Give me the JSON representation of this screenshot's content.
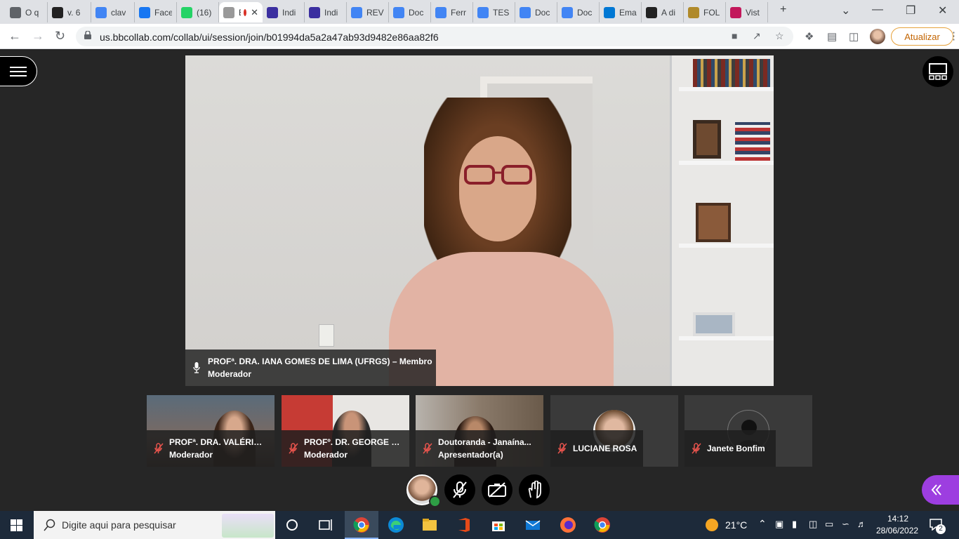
{
  "browser": {
    "tabs": [
      {
        "label": "O q",
        "favicon": "chrome-icon",
        "color": "#5f6368"
      },
      {
        "label": "v. 6",
        "favicon": "pkp-icon",
        "color": "#222222"
      },
      {
        "label": "clav",
        "favicon": "google-icon",
        "color": "#4285f4"
      },
      {
        "label": "Face",
        "favicon": "facebook-icon",
        "color": "#1877f2"
      },
      {
        "label": "(16)",
        "favicon": "whatsapp-icon",
        "color": "#25d366"
      },
      {
        "label": "B",
        "favicon": "collab-icon",
        "color": "#999999"
      },
      {
        "label": "Indi",
        "favicon": "indi-icon",
        "color": "#3b2fa0"
      },
      {
        "label": "Indi",
        "favicon": "indi-icon",
        "color": "#3b2fa0"
      },
      {
        "label": "REV",
        "favicon": "docs-icon",
        "color": "#4285f4"
      },
      {
        "label": "Doc",
        "favicon": "docs-icon",
        "color": "#4285f4"
      },
      {
        "label": "Ferr",
        "favicon": "docs-icon",
        "color": "#4285f4"
      },
      {
        "label": "TES",
        "favicon": "docs-icon",
        "color": "#4285f4"
      },
      {
        "label": "Doc",
        "favicon": "docs-icon",
        "color": "#4285f4"
      },
      {
        "label": "Doc",
        "favicon": "docs-icon",
        "color": "#4285f4"
      },
      {
        "label": "Ema",
        "favicon": "outlook-icon",
        "color": "#0078d4"
      },
      {
        "label": "A di",
        "favicon": "bookmark-icon",
        "color": "#222222"
      },
      {
        "label": "FOL",
        "favicon": "crest-icon",
        "color": "#b08a2a"
      },
      {
        "label": "Vist",
        "favicon": "a-icon",
        "color": "#c2185b"
      }
    ],
    "url": "us.bbcollab.com/collab/ui/session/join/b01994da5a2a47ab93d9482e86aa82f6",
    "update_label": "Atualizar"
  },
  "main_speaker": {
    "caption_line1": "PROFª. DRA. IANA GOMES DE LIMA (UFRGS) – Membro",
    "caption_line2": "Moderador"
  },
  "participants": [
    {
      "name": "PROFª. DRA. VALÉRIA ...",
      "role": "Moderador"
    },
    {
      "name": "PROFº. DR. GEORGE S...",
      "role": "Moderador"
    },
    {
      "name": "Doutoranda - Janaína...",
      "role": "Apresentador(a)"
    },
    {
      "name": "LUCIANE ROSA",
      "role": ""
    },
    {
      "name": "Janete Bonfim",
      "role": ""
    }
  ],
  "taskbar": {
    "search_placeholder": "Digite aqui para pesquisar",
    "weather": "21°C",
    "time": "14:12",
    "date": "28/06/2022",
    "notifications": "2"
  },
  "colors": {
    "accent_purple": "#9d3ee0",
    "status_green": "#2e9e45",
    "mute_red": "#e8544d"
  }
}
